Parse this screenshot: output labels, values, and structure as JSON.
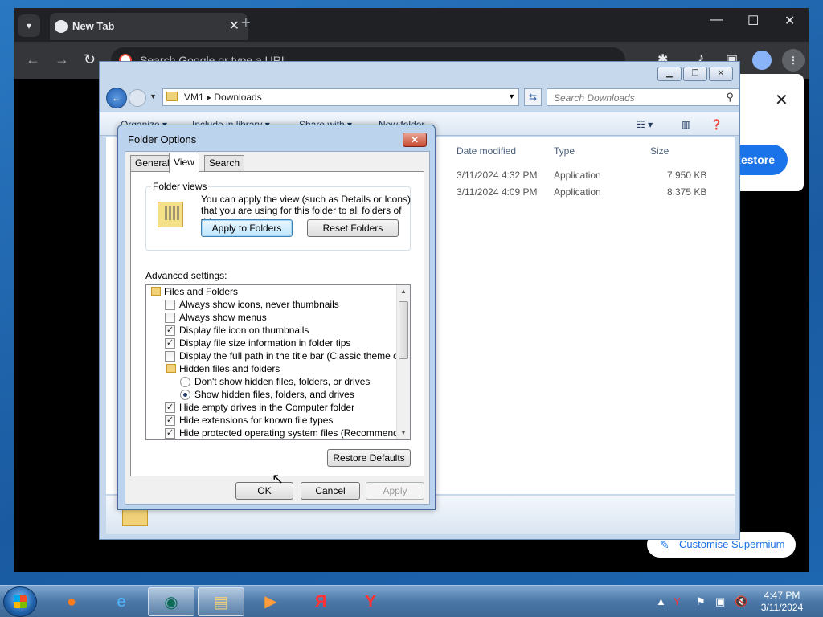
{
  "browser": {
    "tab_title": "New Tab",
    "omnibox_placeholder": "Search Google or type a URL",
    "restore_label": "Restore",
    "customise_label": "Customise Supermium"
  },
  "explorer": {
    "breadcrumb": "VM1  ▸  Downloads",
    "search_placeholder": "Search Downloads",
    "toolbar": {
      "organize": "Organize ▾",
      "include": "Include in library ▾",
      "share": "Share with ▾",
      "new_folder": "New folder"
    },
    "columns": {
      "date_modified": "Date modified",
      "type": "Type",
      "size": "Size"
    },
    "files": [
      {
        "date": "3/11/2024 4:32 PM",
        "type": "Application",
        "size": "7,950 KB"
      },
      {
        "date": "3/11/2024 4:09 PM",
        "type": "Application",
        "size": "8,375 KB"
      }
    ]
  },
  "dialog": {
    "title": "Folder Options",
    "tabs": {
      "general": "General",
      "view": "View",
      "search": "Search"
    },
    "folder_views": {
      "legend": "Folder views",
      "text": "You can apply the view (such as Details or Icons) that you are using for this folder to all folders of this type.",
      "apply_button": "Apply to Folders",
      "reset_button": "Reset Folders"
    },
    "advanced_label": "Advanced settings:",
    "tree": [
      {
        "kind": "folder",
        "label": "Files and Folders",
        "indent": 0
      },
      {
        "kind": "check",
        "label": "Always show icons, never thumbnails",
        "checked": false
      },
      {
        "kind": "check",
        "label": "Always show menus",
        "checked": false
      },
      {
        "kind": "check",
        "label": "Display file icon on thumbnails",
        "checked": true
      },
      {
        "kind": "check",
        "label": "Display file size information in folder tips",
        "checked": true
      },
      {
        "kind": "check",
        "label": "Display the full path in the title bar (Classic theme only)",
        "checked": false
      },
      {
        "kind": "folder",
        "label": "Hidden files and folders",
        "indent": 1
      },
      {
        "kind": "radio",
        "label": "Don't show hidden files, folders, or drives",
        "checked": false
      },
      {
        "kind": "radio",
        "label": "Show hidden files, folders, and drives",
        "checked": true
      },
      {
        "kind": "check",
        "label": "Hide empty drives in the Computer folder",
        "checked": true
      },
      {
        "kind": "check",
        "label": "Hide extensions for known file types",
        "checked": true
      },
      {
        "kind": "check",
        "label": "Hide protected operating system files (Recommended)",
        "checked": true
      }
    ],
    "restore_defaults": "Restore Defaults",
    "ok": "OK",
    "cancel": "Cancel",
    "apply": "Apply"
  },
  "taskbar": {
    "time": "4:47 PM",
    "date": "3/11/2024"
  }
}
